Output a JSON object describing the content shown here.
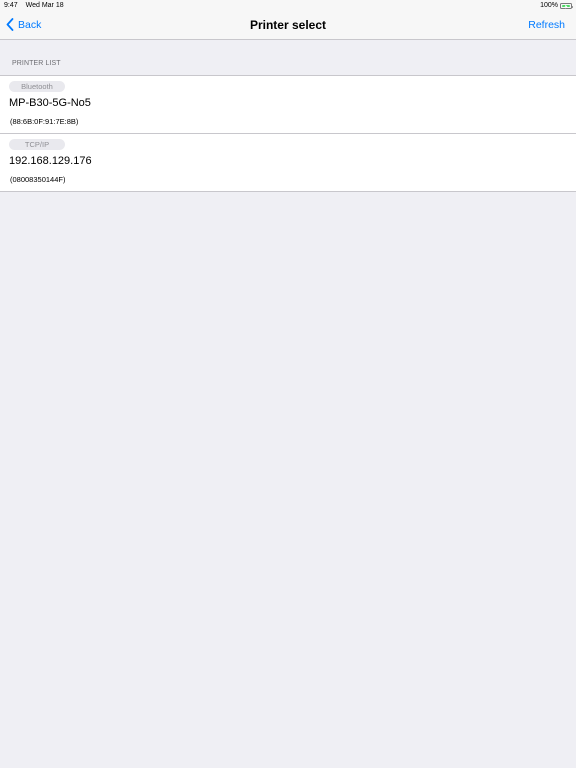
{
  "status_bar": {
    "time": "9:47",
    "date": "Wed Mar 18",
    "battery": "100%"
  },
  "nav": {
    "back_label": "Back",
    "title": "Printer select",
    "refresh_label": "Refresh"
  },
  "section": {
    "header": "PRINTER LIST"
  },
  "printers": [
    {
      "connection": "Bluetooth",
      "name": "MP-B30-5G-No5",
      "id": "(88:6B:0F:91:7E:8B)"
    },
    {
      "connection": "TCP/IP",
      "name": "192.168.129.176",
      "id": "(08008350144F)"
    }
  ],
  "colors": {
    "accent": "#007aff",
    "background": "#efeff4",
    "battery": "#4cd964"
  }
}
